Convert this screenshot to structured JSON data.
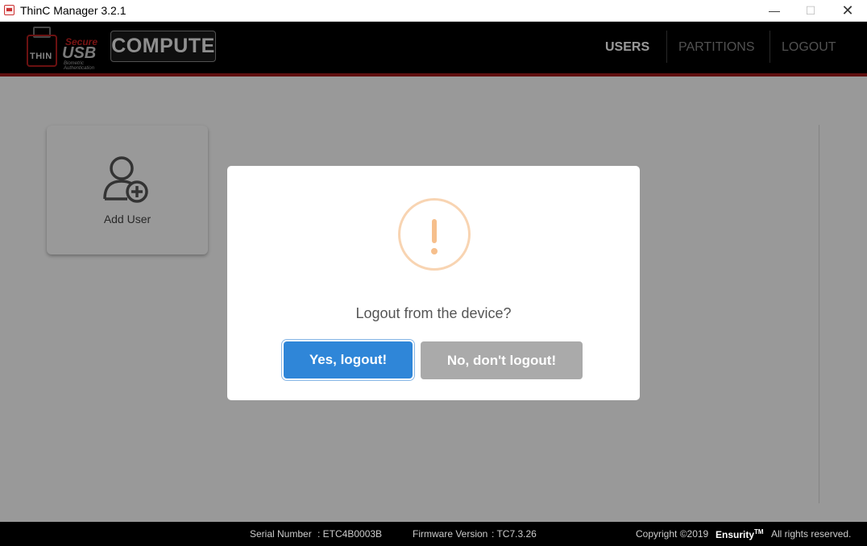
{
  "window": {
    "title": "ThinC Manager 3.2.1",
    "min_glyph": "—",
    "max_glyph": "☐",
    "close_glyph": "✕"
  },
  "header": {
    "logo": {
      "thin": "THIN",
      "secure": "Secure",
      "usb": "USB",
      "bio_line1": "Biometric",
      "bio_line2": "Authentication"
    },
    "badge": "COMPUTE",
    "nav": [
      {
        "label": "USERS",
        "active": true
      },
      {
        "label": "PARTITIONS",
        "active": false
      },
      {
        "label": "LOGOUT",
        "active": false
      }
    ],
    "accent_color": "#a01a1a"
  },
  "main": {
    "add_user_label": "Add User"
  },
  "footer": {
    "serial_label": "Serial Number",
    "serial_value": ": ETC4B0003B",
    "firmware_label": "Firmware Version",
    "firmware_value": ": TC7.3.26",
    "copyright": "Copyright ©2019",
    "brand": "Ensurity",
    "trademark": "TM",
    "rights": "All rights reserved."
  },
  "dialog": {
    "icon": "warning-exclamation-icon",
    "message": "Logout from the device?",
    "confirm_label": "Yes, logout!",
    "cancel_label": "No, don't logout!",
    "confirm_color": "#2f86d8",
    "cancel_color": "#aaaaaa"
  }
}
